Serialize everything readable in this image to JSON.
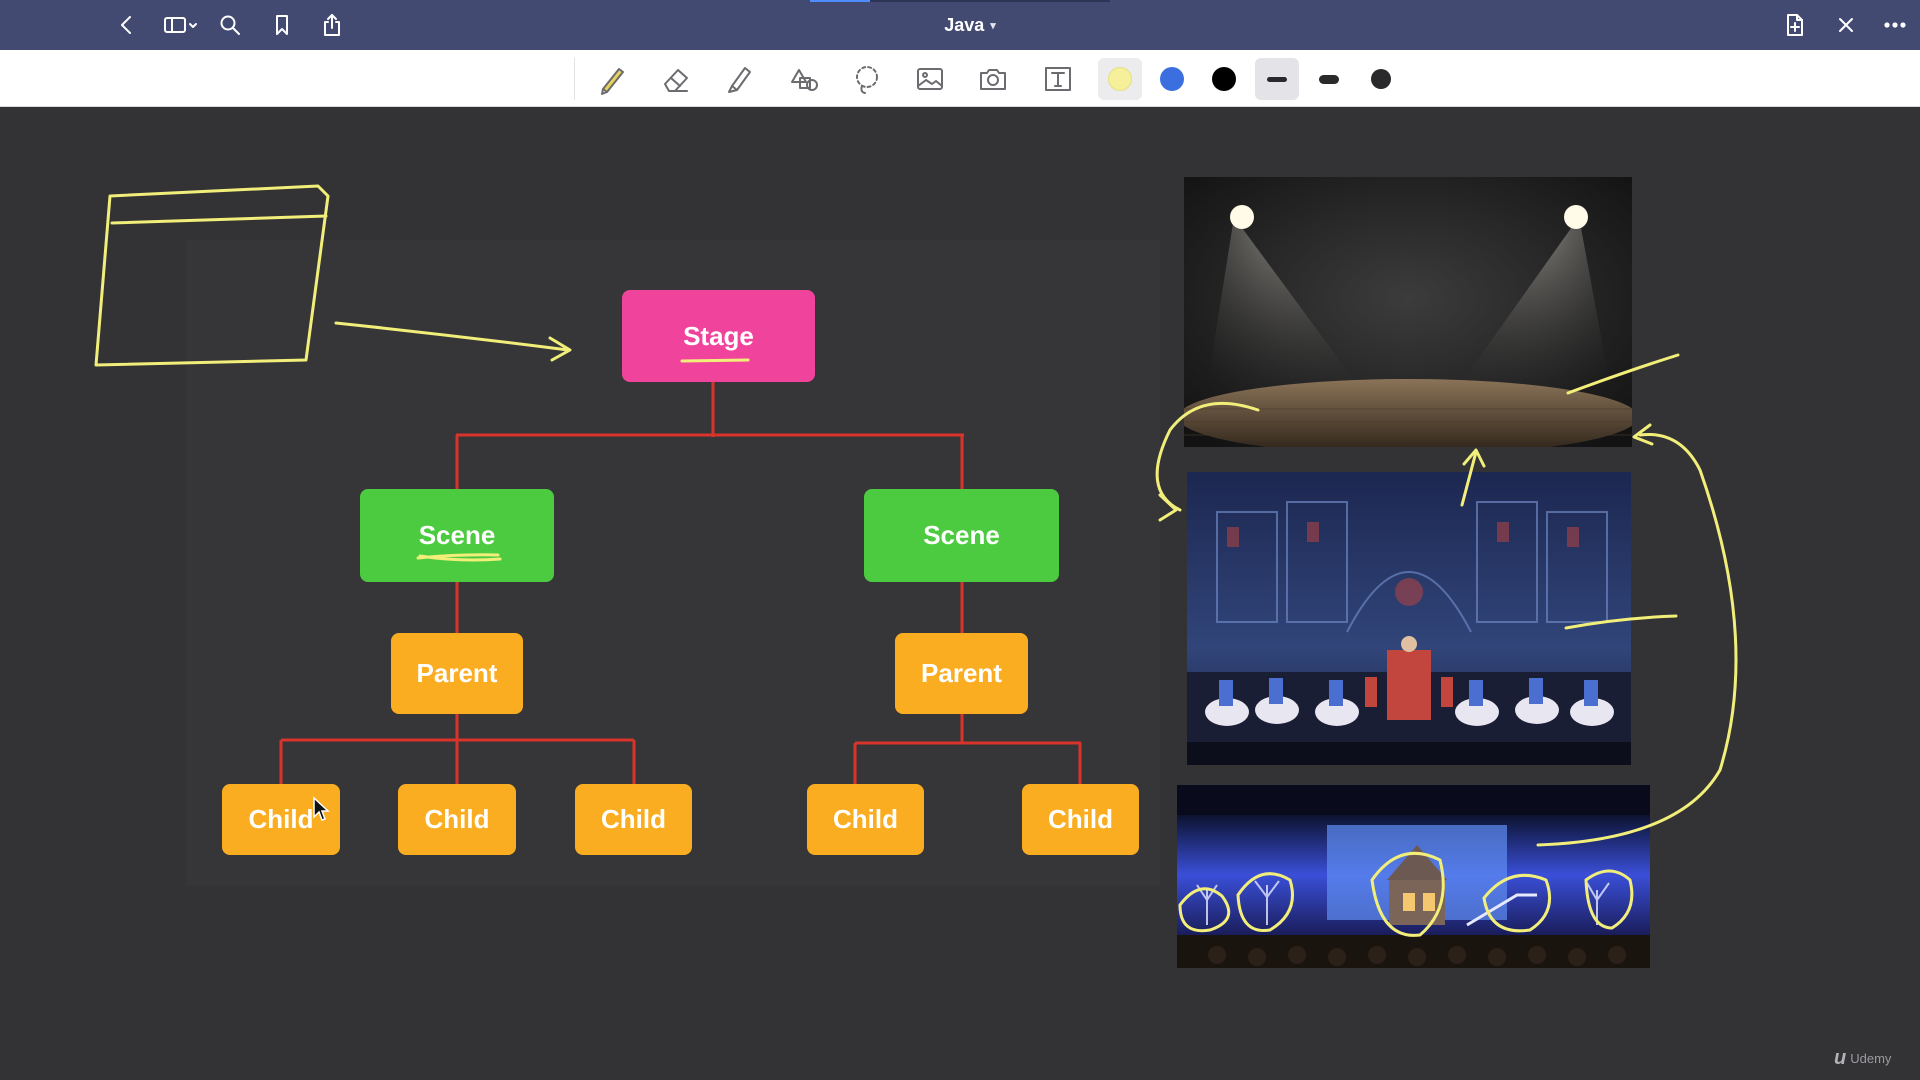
{
  "app": {
    "document_title": "Java",
    "watermark": "Udemy"
  },
  "titlebar": {
    "left_buttons": [
      "back-icon",
      "sidebar-toggle-icon",
      "search-icon",
      "bookmark-icon",
      "share-icon"
    ],
    "right_buttons": [
      "new-page-icon",
      "close-icon",
      "more-icon"
    ]
  },
  "toolbar": {
    "tools": [
      "pen-icon",
      "eraser-icon",
      "highlighter-icon",
      "shapes-icon",
      "lasso-icon",
      "image-icon",
      "camera-icon",
      "text-box-icon"
    ],
    "selected_tool": "pen-icon",
    "colors": [
      "#f7f09a",
      "#3b6fe0",
      "#000000"
    ],
    "selected_color": "#f7f09a",
    "stroke_sizes": [
      "thin",
      "medium",
      "thick"
    ],
    "selected_stroke": "thin"
  },
  "diagram": {
    "stage": "Stage",
    "scenes": [
      "Scene",
      "Scene"
    ],
    "parents": [
      "Parent",
      "Parent"
    ],
    "children_left": [
      "Child",
      "Child",
      "Child"
    ],
    "children_right": [
      "Child",
      "Child"
    ],
    "colors": {
      "stage": "#f0449c",
      "scene": "#4ccb40",
      "parent": "#fbad22",
      "connector": "#d9342b",
      "ink": "#f2ee7a"
    }
  },
  "photos": [
    "empty-stage-photo",
    "dance-performance-photo",
    "theater-set-photo"
  ]
}
